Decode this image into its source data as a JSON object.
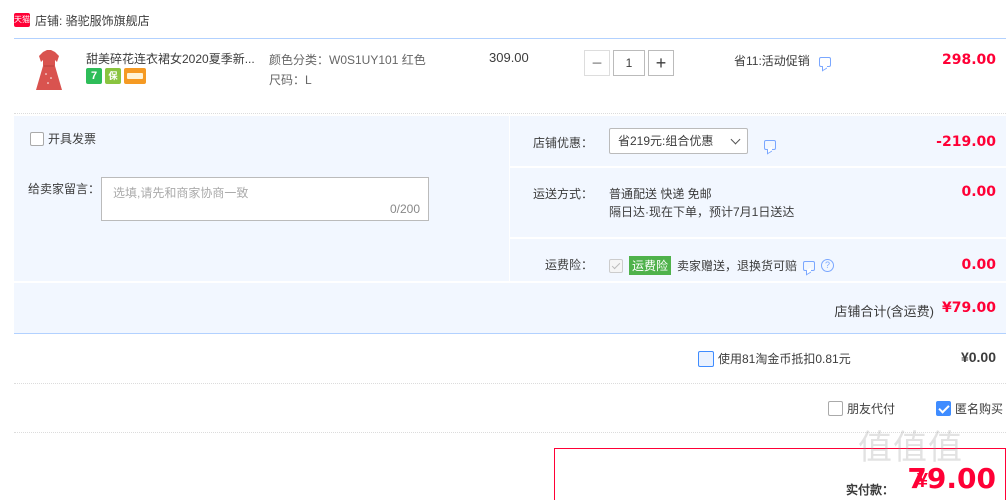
{
  "shop": {
    "badge": "天猫",
    "label": "店铺: 骆驼服饰旗舰店"
  },
  "item": {
    "title": "甜美碎花连衣裙女2020夏季新...",
    "sku_color": "颜色分类：W0S1UY101 红色",
    "sku_size": "尺码：L",
    "unit_price": "309.00",
    "quantity": "1",
    "qty_minus": "−",
    "qty_plus": "+",
    "promo": "省11:活动促销",
    "total": "298.00",
    "service_icons": [
      "7",
      "保",
      "card"
    ],
    "colors": {
      "dress": "#d9534f",
      "icon_green": "#2ebd59",
      "icon_lime": "#8ac43f",
      "icon_orange": "#f59a23"
    }
  },
  "invoice": {
    "label": "开具发票"
  },
  "message": {
    "label": "给卖家留言：",
    "placeholder": "选填,请先和商家协商一致",
    "counter": "0/200"
  },
  "coupon": {
    "label": "店铺优惠：",
    "selected": "省219元:组合优惠",
    "amount": "-219.00"
  },
  "shipping": {
    "label": "运送方式：",
    "line1": "普通配送 快递 免邮",
    "line2": "隔日达·现在下单，预计7月1日送达",
    "amount": "0.00"
  },
  "insurance": {
    "label": "运费险：",
    "tag": "运费险",
    "text": "卖家赠送，退换货可赔",
    "help": "?",
    "amount": "0.00"
  },
  "shop_total": {
    "label": "店铺合计(含运费)",
    "value": "¥79.00"
  },
  "coins": {
    "label": "使用81淘金币抵扣0.81元",
    "value": "¥0.00"
  },
  "options": {
    "friend_pay": "朋友代付",
    "anonymous": "匿名购买"
  },
  "payment": {
    "label": "实付款：",
    "currency": "¥",
    "amount": "79.00"
  },
  "watermark": "值值值",
  "accent": "#ff0036"
}
